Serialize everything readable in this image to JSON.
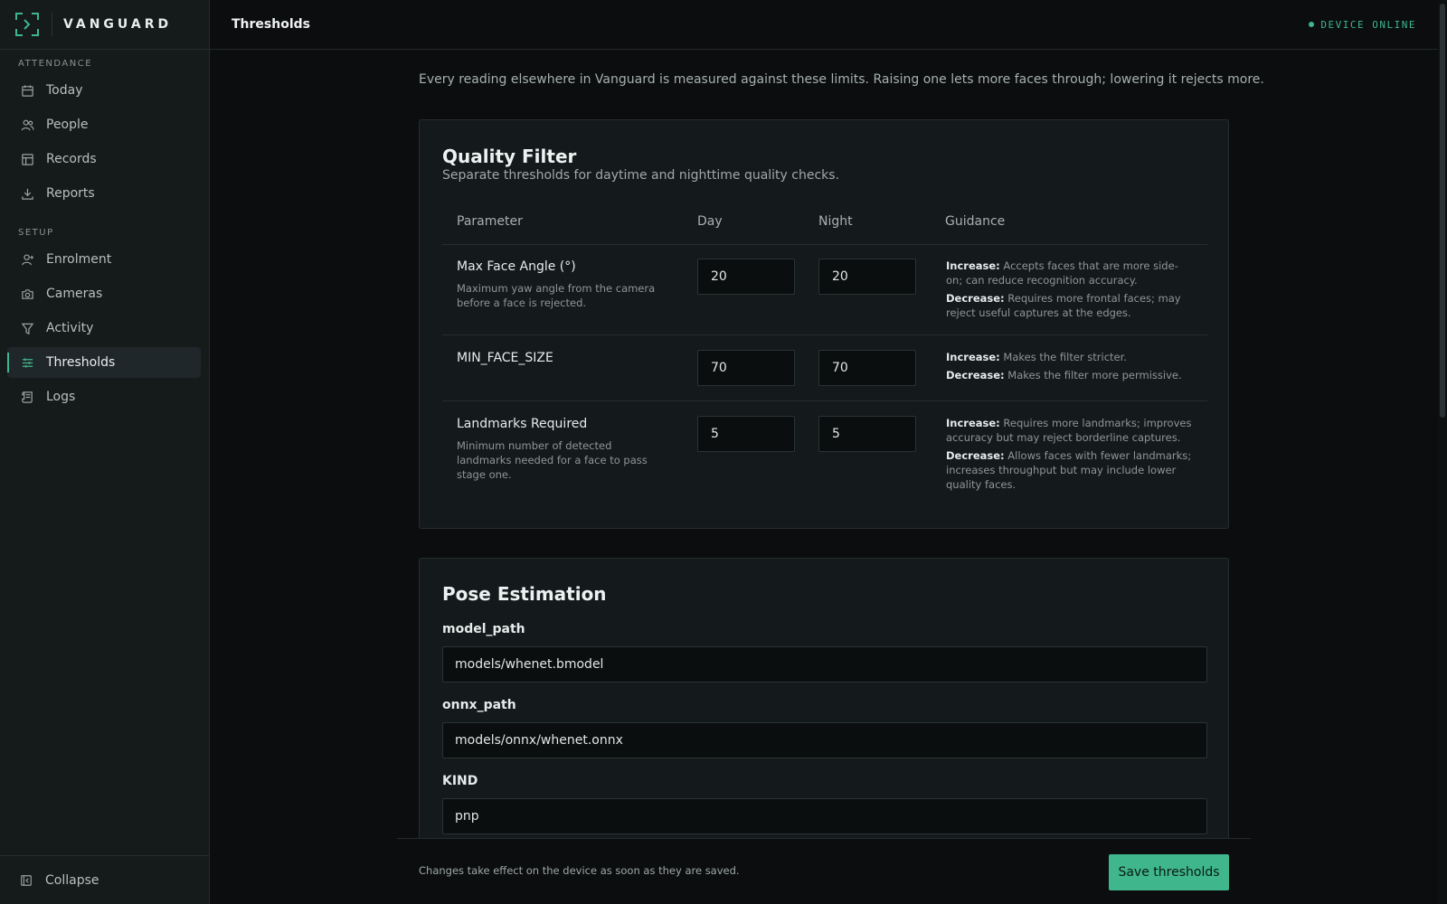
{
  "brand": {
    "name": "VANGUARD"
  },
  "sidebar": {
    "sections": [
      {
        "label": "ATTENDANCE",
        "items": [
          {
            "label": "Today",
            "icon": "calendar-icon"
          },
          {
            "label": "People",
            "icon": "people-icon"
          },
          {
            "label": "Records",
            "icon": "table-icon"
          },
          {
            "label": "Reports",
            "icon": "download-icon"
          }
        ]
      },
      {
        "label": "SETUP",
        "items": [
          {
            "label": "Enrolment",
            "icon": "user-add-icon"
          },
          {
            "label": "Cameras",
            "icon": "camera-icon"
          },
          {
            "label": "Activity",
            "icon": "filter-icon"
          },
          {
            "label": "Thresholds",
            "icon": "sliders-icon",
            "active": true
          },
          {
            "label": "Logs",
            "icon": "scroll-icon"
          }
        ]
      }
    ],
    "collapse_label": "Collapse"
  },
  "header": {
    "title": "Thresholds",
    "status": "DEVICE ONLINE"
  },
  "intro": "Every reading elsewhere in Vanguard is measured against these limits. Raising one lets more faces through; lowering it rejects more.",
  "quality_filter": {
    "title": "Quality Filter",
    "subtitle": "Separate thresholds for daytime and nighttime quality checks.",
    "columns": [
      "Parameter",
      "Day",
      "Night",
      "Guidance"
    ],
    "rows": [
      {
        "name": "Max Face Angle (°)",
        "description": "Maximum yaw angle from the camera before a face is rejected.",
        "day": "20",
        "night": "20",
        "increase_label": "Increase:",
        "increase": "Accepts faces that are more side-on; can reduce recognition accuracy.",
        "decrease_label": "Decrease:",
        "decrease": "Requires more frontal faces; may reject useful captures at the edges."
      },
      {
        "name": "MIN_FACE_SIZE",
        "description": "",
        "day": "70",
        "night": "70",
        "increase_label": "Increase:",
        "increase": "Makes the filter stricter.",
        "decrease_label": "Decrease:",
        "decrease": "Makes the filter more permissive."
      },
      {
        "name": "Landmarks Required",
        "description": "Minimum number of detected landmarks needed for a face to pass stage one.",
        "day": "5",
        "night": "5",
        "increase_label": "Increase:",
        "increase": "Requires more landmarks; improves accuracy but may reject borderline captures.",
        "decrease_label": "Decrease:",
        "decrease": "Allows faces with fewer landmarks; increases throughput but may include lower quality faces."
      }
    ]
  },
  "pose_estimation": {
    "title": "Pose Estimation",
    "fields": [
      {
        "label": "model_path",
        "value": "models/whenet.bmodel"
      },
      {
        "label": "onnx_path",
        "value": "models/onnx/whenet.onnx"
      },
      {
        "label": "KIND",
        "value": "pnp"
      }
    ]
  },
  "footer": {
    "note": "Changes take effect on the device as soon as they are saved.",
    "save_label": "Save thresholds"
  },
  "colors": {
    "accent": "#3fb68b",
    "background": "#0b0d0e",
    "card": "#141a1b"
  }
}
